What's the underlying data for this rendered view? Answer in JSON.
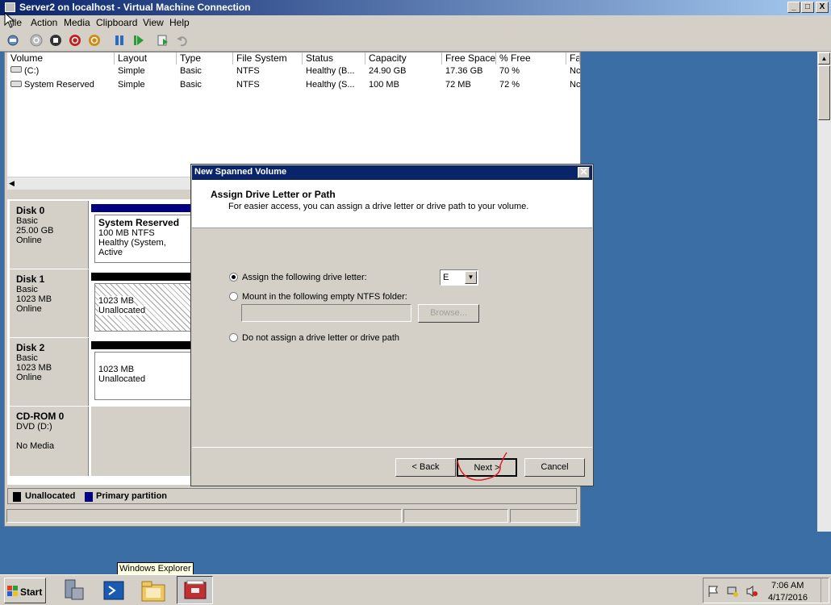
{
  "window": {
    "title": "Server2 on localhost - Virtual Machine Connection",
    "controls": [
      "_",
      "□",
      "X"
    ]
  },
  "menu": [
    "ile",
    "Action",
    "Media",
    "Clipboard",
    "View",
    "Help"
  ],
  "toolbar_icons": [
    "ctrl-alt-del-icon",
    "start-icon",
    "turn-off-icon",
    "shutdown-icon",
    "save-icon",
    "pause-icon",
    "reset-icon",
    "checkpoint-icon",
    "revert-icon"
  ],
  "volumes": {
    "columns": [
      "Volume",
      "Layout",
      "Type",
      "File System",
      "Status",
      "Capacity",
      "Free Space",
      "% Free",
      "Fa"
    ],
    "rows": [
      [
        "(C:)",
        "Simple",
        "Basic",
        "NTFS",
        "Healthy (B...",
        "24.90 GB",
        "17.36 GB",
        "70 %",
        "Nc"
      ],
      [
        "System Reserved",
        "Simple",
        "Basic",
        "NTFS",
        "Healthy (S...",
        "100 MB",
        "72 MB",
        "72 %",
        "Nc"
      ]
    ]
  },
  "disks": [
    {
      "name": "Disk 0",
      "type": "Basic",
      "size": "25.00 GB",
      "state": "Online",
      "part_title": "System Reserved",
      "part_line1": "100 MB NTFS",
      "part_line2": "Healthy (System, Active"
    },
    {
      "name": "Disk 1",
      "type": "Basic",
      "size": "1023 MB",
      "state": "Online",
      "part_line1": "1023 MB",
      "part_line2": "Unallocated"
    },
    {
      "name": "Disk 2",
      "type": "Basic",
      "size": "1023 MB",
      "state": "Online",
      "part_line1": "1023 MB",
      "part_line2": "Unallocated"
    },
    {
      "name": "CD-ROM 0",
      "type": "DVD (D:)",
      "size": "",
      "state": "No Media"
    }
  ],
  "legend": {
    "unallocated": "Unallocated",
    "primary": "Primary partition"
  },
  "dialog": {
    "title": "New Spanned Volume",
    "heading": "Assign Drive Letter or Path",
    "subheading": "For easier access, you can assign a drive letter or drive path to your volume.",
    "option_assign": "Assign the following drive letter:",
    "drive_letter": "E",
    "option_mount": "Mount in the following empty NTFS folder:",
    "browse": "Browse...",
    "option_none": "Do not assign a drive letter or drive path",
    "back": "< Back",
    "next": "Next >",
    "cancel": "Cancel"
  },
  "taskbar": {
    "start": "Start",
    "tooltip": "Windows Explorer",
    "time": "7:06 AM",
    "date": "4/17/2016"
  },
  "colors": {
    "primary_partition": "#000080",
    "unallocated": "#000000",
    "annotation": "#e02020"
  }
}
